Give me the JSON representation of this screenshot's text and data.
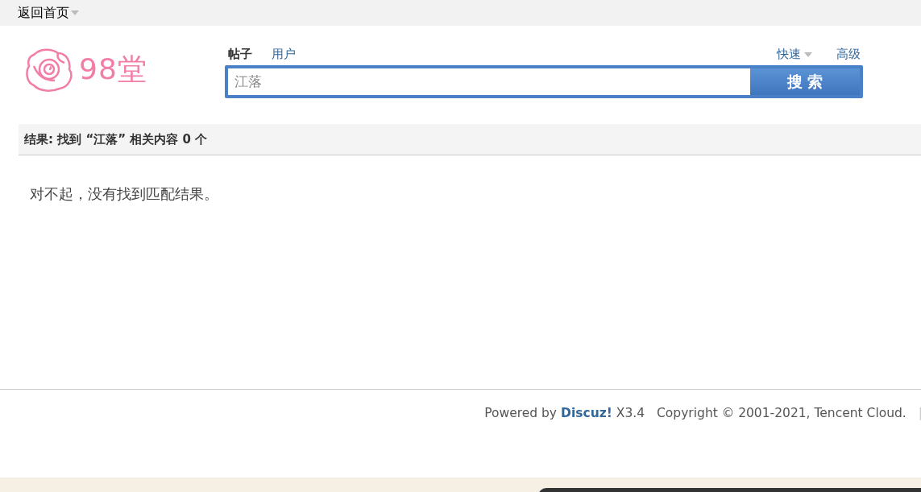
{
  "top_bar": {
    "home_link": "返回首页"
  },
  "logo": {
    "text": "98堂"
  },
  "search": {
    "tabs": [
      {
        "label": "帖子",
        "selected": true
      },
      {
        "label": "用户",
        "selected": false
      }
    ],
    "quick": "快速",
    "advanced": "高级",
    "value": "江落",
    "button": "搜 索"
  },
  "results": {
    "heading": "结果: 找到 “江落” 相关内容 0 个",
    "message": "对不起，没有找到匹配结果。"
  },
  "footer": {
    "powered_by": "Powered by",
    "brand": "Discuz!",
    "version": "X3.4",
    "copyright": "Copyright © 2001-2021, Tencent Cloud.",
    "separator": "|"
  }
}
